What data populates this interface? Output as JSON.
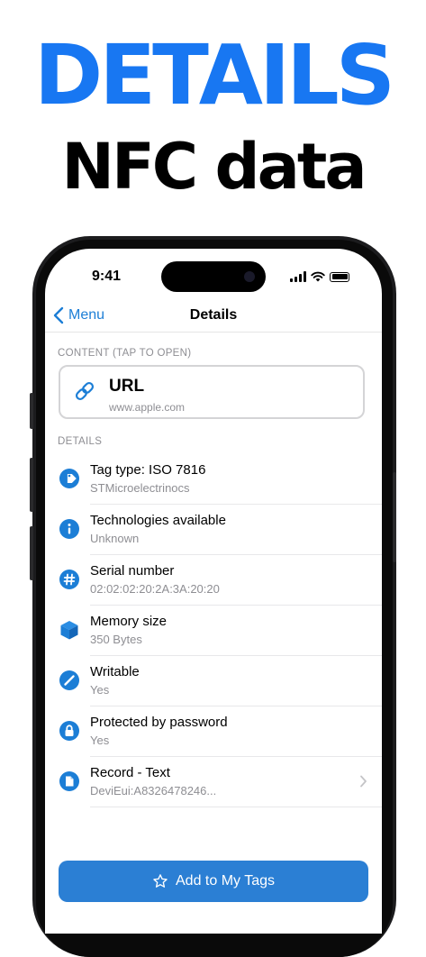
{
  "headline": {
    "title": "DETAILS",
    "subtitle": "NFC data"
  },
  "status_bar": {
    "time": "9:41"
  },
  "nav": {
    "back_label": "Menu",
    "title": "Details"
  },
  "content_section": {
    "label": "CONTENT (TAP TO OPEN)",
    "card": {
      "icon": "link-icon",
      "title": "URL",
      "subtitle": "www.apple.com"
    }
  },
  "details_section": {
    "label": "DETAILS",
    "rows": [
      {
        "icon": "tag-icon",
        "title": "Tag type: ISO 7816",
        "subtitle": "STMicroelectrinocs"
      },
      {
        "icon": "info-icon",
        "title": "Technologies available",
        "subtitle": "Unknown"
      },
      {
        "icon": "number-icon",
        "title": "Serial number",
        "subtitle": "02:02:02:20:2A:3A:20:20"
      },
      {
        "icon": "cube-icon",
        "title": "Memory size",
        "subtitle": "350 Bytes"
      },
      {
        "icon": "pencil-icon",
        "title": "Writable",
        "subtitle": "Yes"
      },
      {
        "icon": "lock-icon",
        "title": "Protected by password",
        "subtitle": "Yes"
      },
      {
        "icon": "document-icon",
        "title": "Record - Text",
        "subtitle": "DeviEui:A8326478246..."
      }
    ]
  },
  "action": {
    "icon": "star-icon",
    "label": "Add to My Tags"
  },
  "colors": {
    "accent": "#2b7fd4",
    "headline_blue": "#1877f2",
    "icon_blue": "#1c7ed6"
  }
}
